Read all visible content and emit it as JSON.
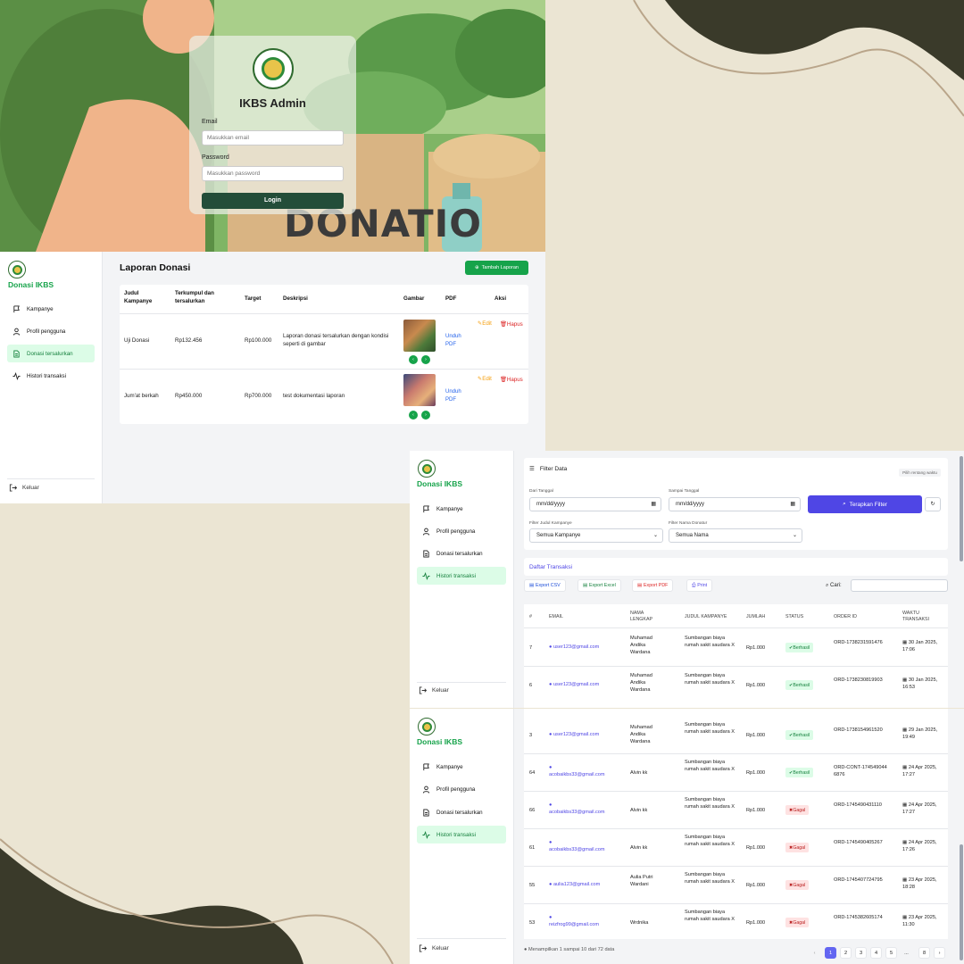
{
  "login": {
    "title": "IKBS Admin",
    "email_label": "Email",
    "email_placeholder": "Masukkan email",
    "password_label": "Password",
    "password_placeholder": "Masukkan password",
    "login_button": "Login",
    "poster_text": "DONATIO"
  },
  "sidebar": {
    "brand": "Donasi IKBS",
    "items": [
      "Kampanye",
      "Profil pengguna",
      "Donasi tersalurkan",
      "Histori transaksi"
    ],
    "logout": "Keluar"
  },
  "report": {
    "title": "Laporan Donasi",
    "add_button": "Tambah Laporan",
    "headers": [
      "Judul Kampanye",
      "Terkumpul dan tersalurkan",
      "Target",
      "Deskripsi",
      "Gambar",
      "PDF",
      "Aksi"
    ],
    "rows": [
      {
        "judul": "Uji Donasi",
        "terkumpul": "Rp132.456",
        "target": "Rp100.000",
        "deskripsi": "Laporan donasi tersalurkan dengan kondisi seperti di gambar",
        "pdf": "Unduh PDF",
        "edit": "Edit",
        "hapus": "Hapus"
      },
      {
        "judul": "Jum'at berkah",
        "terkumpul": "Rp450.000",
        "target": "Rp700.000",
        "deskripsi": "test dokumentasi laporan",
        "pdf": "Unduh PDF",
        "edit": "Edit",
        "hapus": "Hapus"
      }
    ]
  },
  "filter": {
    "title": "Filter Data",
    "range_hint": "Pilih rentang waktu",
    "from_label": "Dari Tanggal",
    "to_label": "Sampai Tanggal",
    "date_placeholder": "mm/dd/yyyy",
    "apply_button": "Terapkan Filter",
    "campaign_label": "Filter Judul Kampanye",
    "campaign_value": "Semua Kampanye",
    "donor_label": "Filter Nama Donatur",
    "donor_value": "Semua Nama"
  },
  "transactions": {
    "title": "Daftar Transaksi",
    "export_csv": "Export CSV",
    "export_excel": "Export Excel",
    "export_pdf": "Export PDF",
    "print": "Print",
    "search_label": "Cari:",
    "headers": [
      "#",
      "EMAIL",
      "NAMA LENGKAP",
      "JUDUL KAMPANYE",
      "JUMLAH",
      "STATUS",
      "ORDER ID",
      "WAKTU TRANSAKSI"
    ],
    "rows_top": [
      {
        "no": "7",
        "email": "user123@gmail.com",
        "nama": "Muhamad Andika Wardana",
        "judul": "Sumbangan biaya rumah sakit saudara X",
        "jumlah": "Rp1.000",
        "status": "Berhasil",
        "order": "ORD-1738231591476",
        "waktu": "30 Jan 2025, 17:06"
      },
      {
        "no": "6",
        "email": "user123@gmail.com",
        "nama": "Muhamad Andika Wardana",
        "judul": "Sumbangan biaya rumah sakit saudara X",
        "jumlah": "Rp1.000",
        "status": "Berhasil",
        "order": "ORD-1738230819903",
        "waktu": "30 Jan 2025, 16:53"
      }
    ],
    "rows_bottom": [
      {
        "no": "3",
        "email": "user123@gmail.com",
        "nama": "Muhamad Andika Wardana",
        "judul": "Sumbangan biaya rumah sakit saudara X",
        "jumlah": "Rp1.000",
        "status": "Berhasil",
        "order": "ORD-1738154961520",
        "waktu": "29 Jan 2025, 19:49"
      },
      {
        "no": "64",
        "email": "acobaikbs33@gmail.com",
        "nama": "Alvin kk",
        "judul": "Sumbangan biaya rumah sakit saudara X",
        "jumlah": "Rp1.000",
        "status": "Berhasil",
        "order": "ORD-CONT-1745490446876",
        "waktu": "24 Apr 2025, 17:27"
      },
      {
        "no": "66",
        "email": "acobaikbs33@gmail.com",
        "nama": "Alvin kk",
        "judul": "Sumbangan biaya rumah sakit saudara X",
        "jumlah": "Rp1.000",
        "status": "Gagal",
        "order": "ORD-1745490431110",
        "waktu": "24 Apr 2025, 17:27"
      },
      {
        "no": "61",
        "email": "acobaikbs33@gmail.com",
        "nama": "Alvin kk",
        "judul": "Sumbangan biaya rumah sakit saudara X",
        "jumlah": "Rp1.000",
        "status": "Gagal",
        "order": "ORD-1745490405267",
        "waktu": "24 Apr 2025, 17:26"
      },
      {
        "no": "55",
        "email": "aulia123@gmail.com",
        "nama": "Aulia Putri Wardani",
        "judul": "Sumbangan biaya rumah sakit saudara X",
        "jumlah": "Rp1.000",
        "status": "Gagal",
        "order": "ORD-1745407724795",
        "waktu": "23 Apr 2025, 18:28"
      },
      {
        "no": "53",
        "email": "reizfrog99@gmail.com",
        "nama": "Wrdnika",
        "judul": "Sumbangan biaya rumah sakit saudara X",
        "jumlah": "Rp1.000",
        "status": "Gagal",
        "order": "ORD-1745382605174",
        "waktu": "23 Apr 2025, 11:30"
      }
    ],
    "info": "Menampilkan 1 sampai 10 dari 72 data",
    "pages": [
      "1",
      "2",
      "3",
      "4",
      "5",
      "...",
      "8"
    ],
    "prev": "‹",
    "next": "›"
  },
  "colors": {
    "accent": "#16a34a",
    "primary": "#4f46e5",
    "danger": "#dc2626"
  }
}
